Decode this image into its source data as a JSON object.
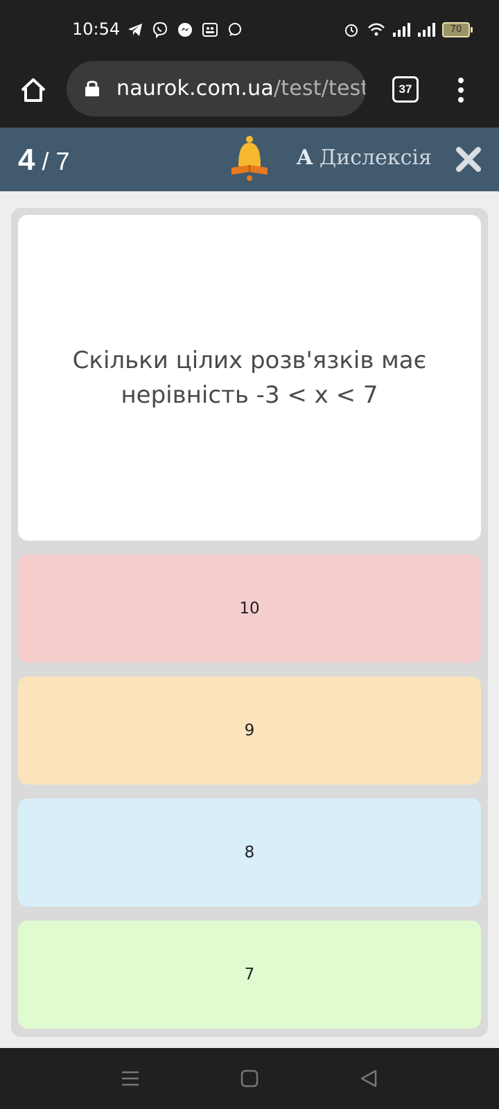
{
  "status_bar": {
    "time": "10:54",
    "left_icons": [
      "telegram-icon",
      "viber-icon",
      "messenger-icon",
      "gallery-icon",
      "chat-icon"
    ],
    "right_icons": [
      "alarm-icon",
      "wifi-icon",
      "signal-icon",
      "signal-icon"
    ],
    "battery": "70"
  },
  "browser": {
    "url_host": "naurok.com.ua",
    "url_path": "/test/test",
    "tab_count": "37"
  },
  "quiz_header": {
    "current": "4",
    "separator": " / ",
    "total": "7",
    "dyslexia_letter": "A",
    "dyslexia_label": "Дислексія"
  },
  "question": {
    "text": "Скільки цілих розв'язків має нерівність -3 < x < 7"
  },
  "answers": [
    {
      "label": "10",
      "color": "#f6cdcd"
    },
    {
      "label": "9",
      "color": "#fbe3bb"
    },
    {
      "label": "8",
      "color": "#d8eff9"
    },
    {
      "label": "7",
      "color": "#e1fbd0"
    }
  ],
  "colors": {
    "header": "#415a6e",
    "bell": "#f5a623"
  }
}
